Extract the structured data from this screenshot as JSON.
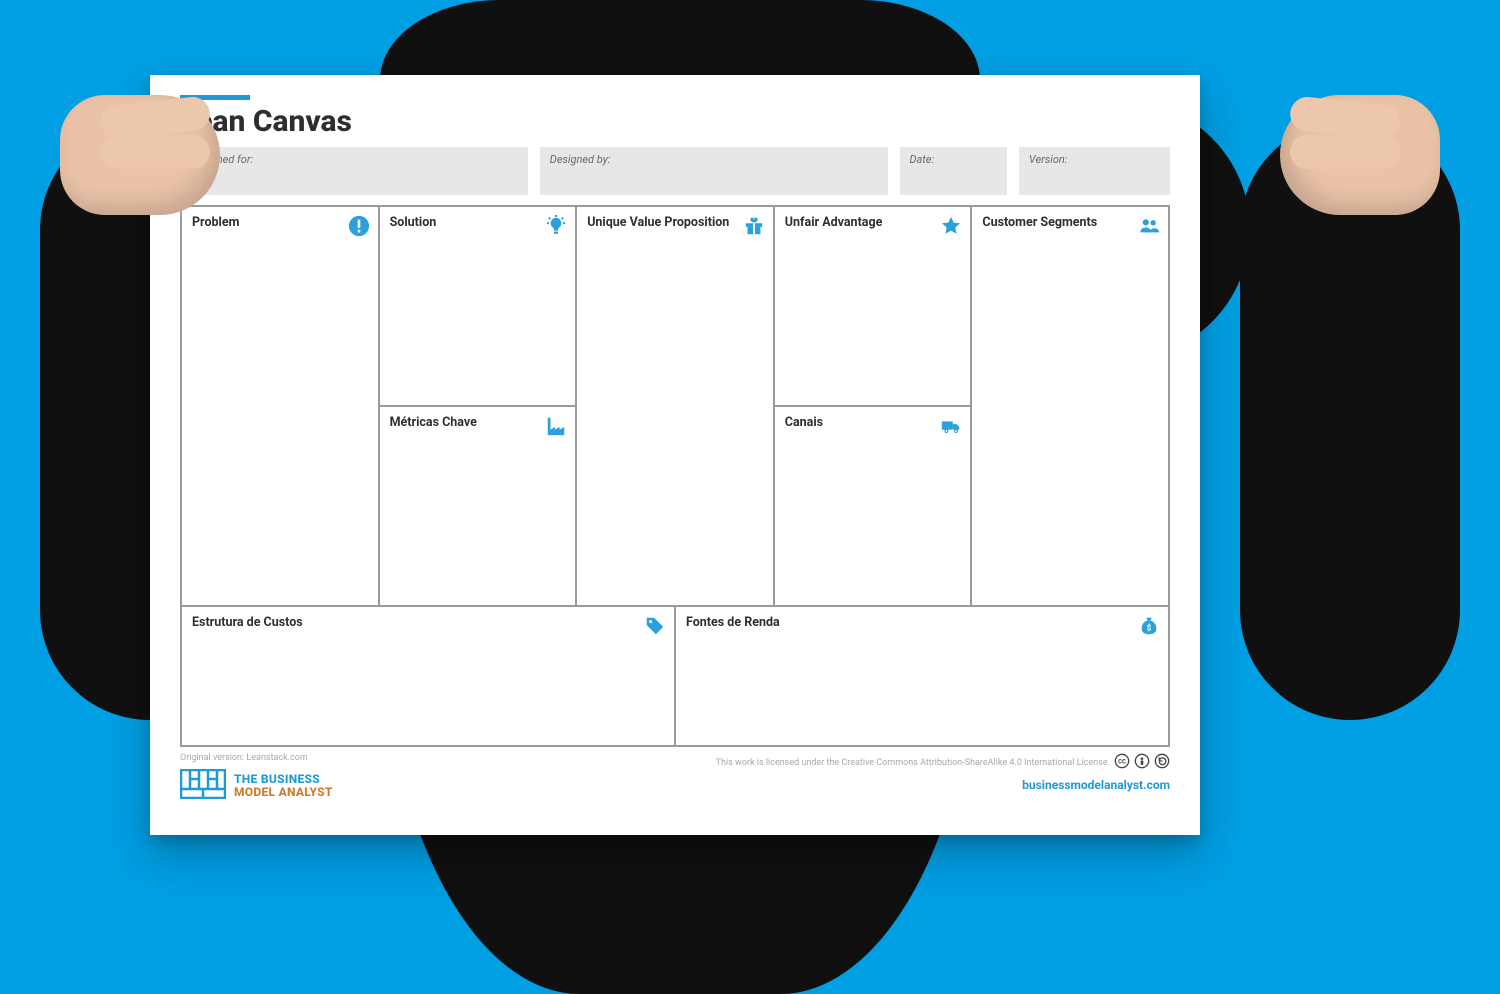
{
  "title": "Lean Canvas",
  "meta": {
    "designed_for_label": "Designed for:",
    "designed_by_label": "Designed by:",
    "date_label": "Date:",
    "version_label": "Version:"
  },
  "sections": {
    "problem": "Problem",
    "solution": "Solution",
    "metrics": "Métricas Chave",
    "uvp": "Unique Value Proposition",
    "unfair": "Unfair Advantage",
    "channels": "Canais",
    "segments": "Customer Segments",
    "costs": "Estrutura de Custos",
    "revenue": "Fontes de Renda"
  },
  "footer": {
    "original": "Original version: Leanstack.com",
    "license": "This work is licensed under the Creative Commons Attribution-ShareAlike 4.0 International License.",
    "site": "businessmodelanalyst.com"
  },
  "brand": {
    "line1": "THE BUSINESS",
    "line2": "MODEL ANALYST"
  },
  "colors": {
    "accent": "#1e9ad6",
    "background": "#009fe3"
  }
}
